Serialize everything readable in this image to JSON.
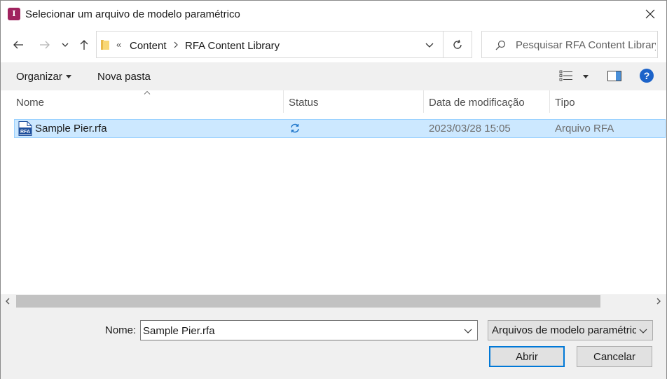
{
  "window": {
    "title": "Selecionar um arquivo de modelo paramétrico",
    "app_icon_letter": "I",
    "app_icon_color": "#a0235f"
  },
  "navigation": {
    "breadcrumb_overflow": "«",
    "breadcrumbs": [
      "Content",
      "RFA Content Library"
    ],
    "search_placeholder": "Pesquisar RFA Content Library"
  },
  "toolbar": {
    "organize_label": "Organizar",
    "new_folder_label": "Nova pasta",
    "help_label": "?",
    "help_color": "#1c63c9"
  },
  "file_list": {
    "columns": [
      "Nome",
      "Status",
      "Data de modificação",
      "Tipo"
    ],
    "rows": [
      {
        "name": "Sample Pier.rfa",
        "status_icon": "sync-icon",
        "date": "2023/03/28 15:05",
        "type": "Arquivo RFA",
        "selected": true
      }
    ],
    "selection_color": "#cce8ff"
  },
  "footer": {
    "name_label": "Nome:",
    "name_value": "Sample Pier.rfa",
    "file_type_value": "Arquivos de modelo paramétrico",
    "open_label": "Abrir",
    "cancel_label": "Cancelar",
    "focus_color": "#0078d7"
  }
}
